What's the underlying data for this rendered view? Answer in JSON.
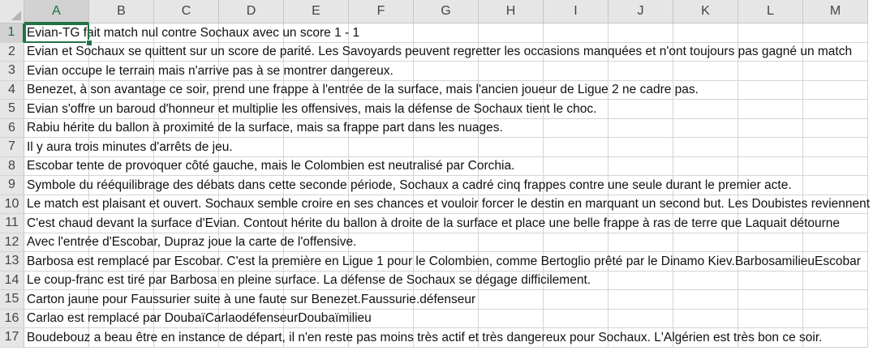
{
  "columns": [
    "A",
    "B",
    "C",
    "D",
    "E",
    "F",
    "G",
    "H",
    "I",
    "J",
    "K",
    "L",
    "M"
  ],
  "active_column": "A",
  "active_row": 1,
  "rows": [
    {
      "num": "1",
      "a": "Evian-TG fait match nul contre Sochaux avec un score 1 - 1"
    },
    {
      "num": "2",
      "a": "Evian et Sochaux se quittent sur un score de parité. Les Savoyards peuvent regretter les occasions manquées et n'ont toujours pas gagné un match"
    },
    {
      "num": "3",
      "a": "Evian occupe le terrain mais n'arrive pas à se montrer dangereux."
    },
    {
      "num": "4",
      "a": "Benezet, à son avantage ce soir, prend une frappe à l'entrée de la surface, mais l'ancien joueur de Ligue 2 ne cadre pas."
    },
    {
      "num": "5",
      "a": "Evian s'offre un baroud d'honneur et multiplie les offensives, mais la défense de Sochaux tient le choc."
    },
    {
      "num": "6",
      "a": "Rabiu hérite du ballon à proximité de la surface, mais sa frappe part dans les nuages."
    },
    {
      "num": "7",
      "a": "Il y aura trois minutes d'arrêts de jeu."
    },
    {
      "num": "8",
      "a": "Escobar tente de provoquer côté gauche, mais le Colombien est neutralisé par Corchia."
    },
    {
      "num": "9",
      "a": "Symbole du rééquilibrage des débats dans cette seconde période, Sochaux a cadré cinq frappes contre une seule durant le premier acte."
    },
    {
      "num": "10",
      "a": "Le match est plaisant et ouvert. Sochaux semble croire en ses chances et vouloir forcer le destin en marquant un second but. Les Doubistes reviennent"
    },
    {
      "num": "11",
      "a": "C'est chaud devant la surface d'Evian. Contout hérite du ballon à droite de la surface et place une belle frappe à ras de terre que Laquait détourne"
    },
    {
      "num": "12",
      "a": "Avec l'entrée d'Escobar, Dupraz joue la carte de l'offensive."
    },
    {
      "num": "13",
      "a": "Barbosa est remplacé par Escobar. C'est la première en Ligue 1 pour le Colombien, comme Bertoglio prêté par le Dinamo Kiev.BarbosamilieuEscobar"
    },
    {
      "num": "14",
      "a": "Le coup-franc est tiré par Barbosa en pleine surface. La défense de Sochaux se dégage difficilement."
    },
    {
      "num": "15",
      "a": "Carton jaune pour Faussurier suite à une faute sur Benezet.Faussurie.défenseur"
    },
    {
      "num": "16",
      "a": "Carlao est remplacé par DoubaïCarlaodéfenseurDoubaïmilieu"
    },
    {
      "num": "17",
      "a": "Boudebouz a beau être en instance de départ, il n'en reste pas moins très actif et très dangereux pour Sochaux. L'Algérien est très bon ce soir."
    }
  ],
  "colors": {
    "accent": "#217346",
    "header_bg": "#e6e6e6",
    "gridline": "#d4d4d4"
  }
}
